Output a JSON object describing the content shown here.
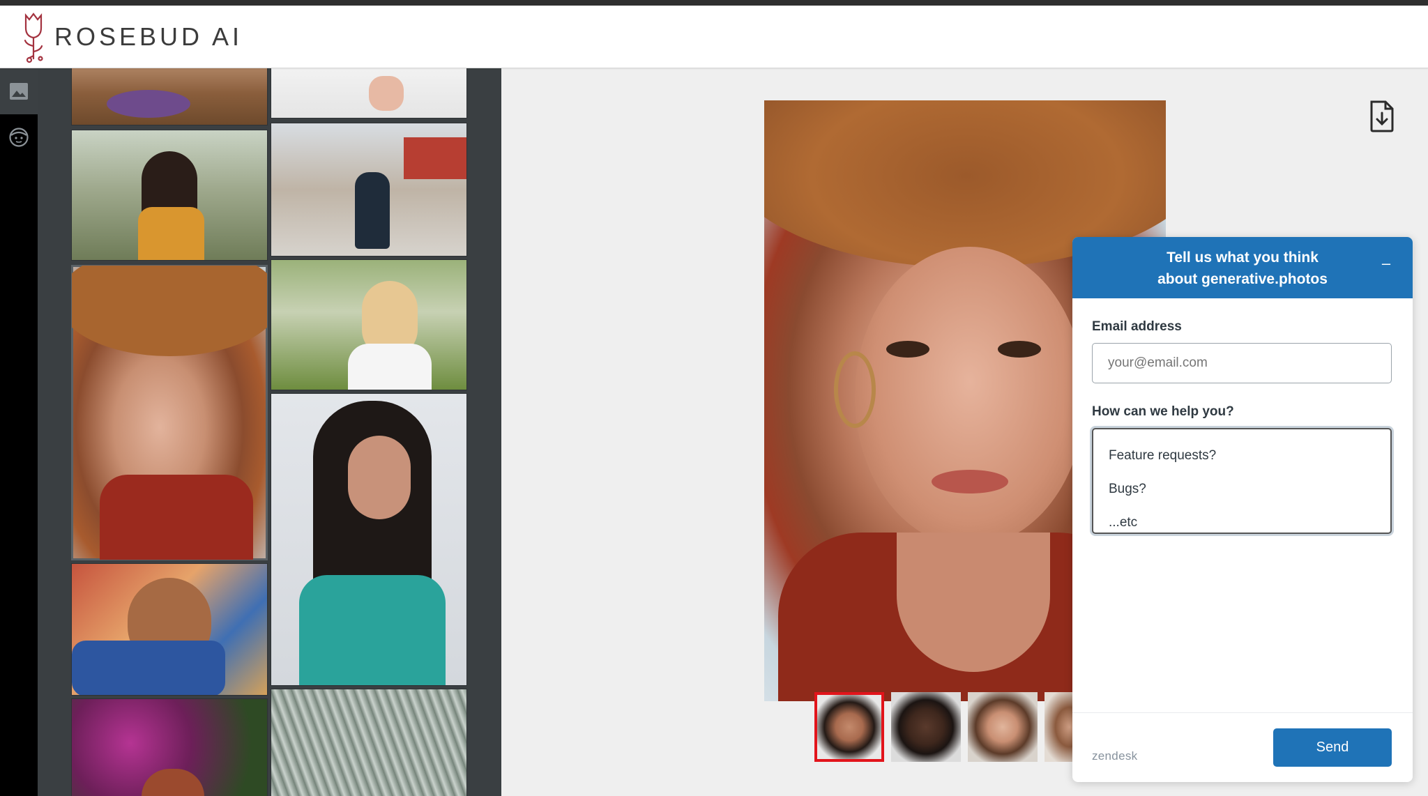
{
  "app": {
    "brand": "ROSEBUD AI",
    "colors": {
      "header_bg": "#ffffff",
      "sidebar_bg": "#3a3f42",
      "rail_bg": "#000000",
      "accent": "#1f73b7",
      "selected_face": "#e2141b"
    }
  },
  "rail": {
    "items": [
      {
        "icon": "image-icon",
        "active": true
      },
      {
        "icon": "face-icon",
        "active": false
      }
    ]
  },
  "gallery": {
    "photos": [
      {
        "icon": "yoga-mat-photo"
      },
      {
        "icon": "bare-feet-photo"
      },
      {
        "icon": "woman-in-grass-photo"
      },
      {
        "icon": "woman-in-snowy-street-photo"
      },
      {
        "icon": "freckled-woman-straw-hat-photo",
        "selected": true
      },
      {
        "icon": "blonde-woman-park-photo"
      },
      {
        "icon": "dark-haired-woman-teal-shirt-photo"
      },
      {
        "icon": "woman-lying-on-blanket-photo"
      },
      {
        "icon": "woman-with-flowers-photo"
      },
      {
        "icon": "palm-leaves-photo"
      }
    ]
  },
  "viewer": {
    "download_icon": "file-download-icon",
    "face_strip": [
      {
        "icon": "face-thumbnail-1",
        "active": true
      },
      {
        "icon": "face-thumbnail-2",
        "active": false
      },
      {
        "icon": "face-thumbnail-3",
        "active": false
      },
      {
        "icon": "face-thumbnail-4",
        "active": false
      }
    ]
  },
  "feedback": {
    "title": "Tell us what you think\nabout generative.photos",
    "minimize": "–",
    "email_label": "Email address",
    "email_placeholder": "your@email.com",
    "help_label": "How can we help you?",
    "help_value": "Feature requests?\nBugs?\n...etc",
    "footer_brand": "zendesk",
    "send_label": "Send"
  }
}
